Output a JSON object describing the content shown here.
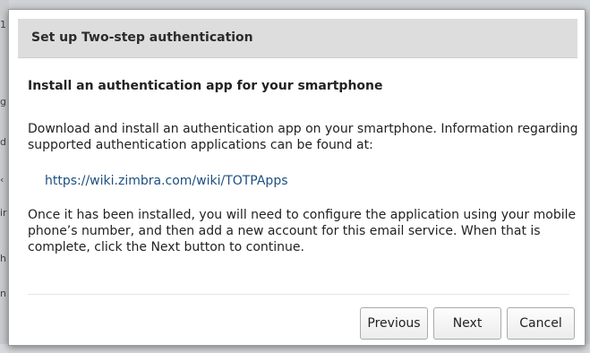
{
  "dialog": {
    "title": "Set up Two-step authentication",
    "heading": "Install an authentication app for your smartphone",
    "paragraph1": "Download and install an authentication app on your smartphone. Information regarding supported authentication applications can be found at:",
    "link": "https://wiki.zimbra.com/wiki/TOTPApps",
    "paragraph2": "Once it has been installed, you will need to configure the application using your mobile phone’s number, and then add a new account for this email service. When that is complete, click the Next button to continue.",
    "buttons": {
      "previous": "Previous",
      "next": "Next",
      "cancel": "Cancel"
    }
  },
  "background": {
    "fragments": [
      "1",
      "g",
      "d",
      "‹",
      "ir",
      "h",
      "n"
    ]
  },
  "colors": {
    "link": "#1d4f80",
    "header_bg": "#dddddd",
    "backdrop": "#cfd2d6"
  }
}
